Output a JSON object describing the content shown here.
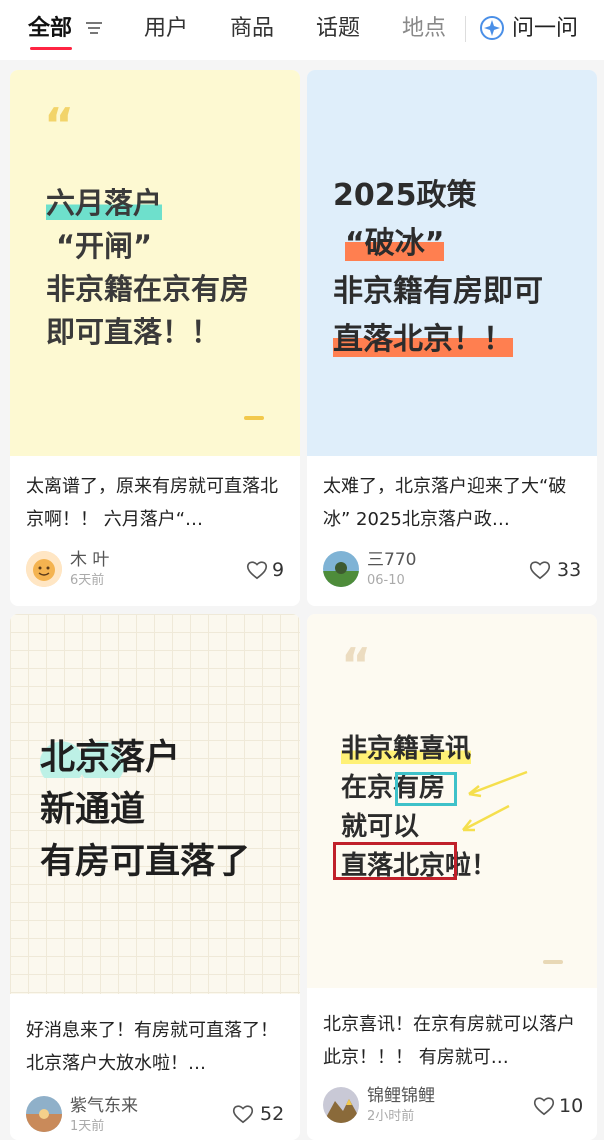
{
  "tabs": {
    "all": "全部",
    "users": "用户",
    "products": "商品",
    "topics": "话题",
    "places": "地点",
    "ask": "问一问"
  },
  "colors": {
    "accent": "#ff2442"
  },
  "cards": [
    {
      "cover_lines": [
        "六月落户",
        "“开闸”",
        "非京籍在京有房",
        "即可直落！！"
      ],
      "caption": "太离谱了，原来有房就可直落北京啊！！ 六月落户“…",
      "author": "木 叶",
      "time": "6天前",
      "likes": "9"
    },
    {
      "cover_lines": [
        "2025政策",
        "“破冰”",
        "非京籍有房即可",
        "直落北京！！"
      ],
      "caption": "太难了，北京落户迎来了大“破冰” 2025北京落户政…",
      "author": "三770",
      "time": "06-10",
      "likes": "33"
    },
    {
      "cover_lines": [
        "北京落户",
        "新通道",
        "有房可直落了"
      ],
      "caption": "好消息来了！有房就可直落了！ 北京落户大放水啦！…",
      "author": "紫气东来",
      "time": "1天前",
      "likes": "52"
    },
    {
      "cover_lines": [
        "非京籍喜讯",
        "在京有房",
        "就可以",
        "直落北京啦！"
      ],
      "caption": "北京喜讯！在京有房就可以落户此京！！！ 有房就可…",
      "author": "锦鲤锦鲤",
      "time": "2小时前",
      "likes": "10"
    }
  ]
}
